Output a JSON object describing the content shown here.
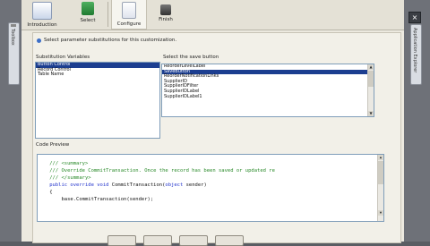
{
  "left_tab": {
    "label": "Toolbox"
  },
  "right_tab": {
    "label": "Application Explorer"
  },
  "toolbar": {
    "steps": [
      {
        "label": "Introduction"
      },
      {
        "label": "Select"
      },
      {
        "label": "Configure"
      },
      {
        "label": "Finish"
      }
    ]
  },
  "window": {
    "close_glyph": "×"
  },
  "panel": {
    "instruction": "Select parameter substitutions for this customization.",
    "substitution_label": "Substitution Variables",
    "substitution_items": [
      "Button Control",
      "Record Control",
      "Table Name"
    ],
    "substitution_selected": 0,
    "save_label": "Select the save button",
    "save_items": [
      "ReorderLevelLabel",
      "SaveButton",
      "ReorderNotificationLinks",
      "SupplierID",
      "SupplierIDFilter",
      "SupplierIDLabel",
      "SupplierIDLabel1"
    ],
    "save_selected": 1,
    "code_label": "Code Preview",
    "code_lines": [
      {
        "segments": [
          {
            "t": "    /// <summary>",
            "c": "comment"
          }
        ]
      },
      {
        "segments": [
          {
            "t": "    /// Override CommitTransaction. Once the record has been saved or updated re",
            "c": "comment"
          }
        ]
      },
      {
        "segments": [
          {
            "t": "    /// </summary>",
            "c": "comment"
          }
        ]
      },
      {
        "segments": [
          {
            "t": "    public override void ",
            "c": "kw"
          },
          {
            "t": "CommitTransaction(",
            "c": "plain"
          },
          {
            "t": "object",
            "c": "kw"
          },
          {
            "t": " sender)",
            "c": "plain"
          }
        ]
      },
      {
        "segments": [
          {
            "t": "    {",
            "c": "plain"
          }
        ]
      },
      {
        "segments": [
          {
            "t": "        base.CommitTransaction(sender);",
            "c": "plain"
          }
        ]
      }
    ]
  },
  "colors": {
    "accent": "#1c3e90",
    "comment": "#2a8a2a",
    "keyword": "#2233cc"
  },
  "icons": [
    "introduction-icon",
    "select-icon",
    "configure-icon",
    "finish-icon",
    "info-icon",
    "close-icon"
  ]
}
